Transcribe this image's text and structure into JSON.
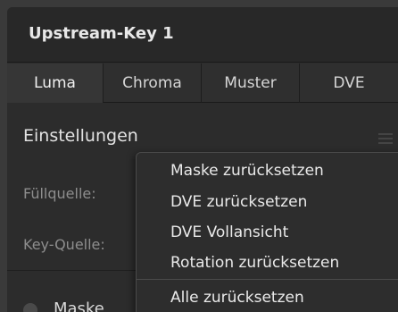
{
  "panel": {
    "title": "Upstream-Key 1",
    "tabs": [
      {
        "label": "Luma",
        "active": true
      },
      {
        "label": "Chroma",
        "active": false
      },
      {
        "label": "Muster",
        "active": false
      },
      {
        "label": "DVE",
        "active": false
      }
    ]
  },
  "settings": {
    "title": "Einstellungen",
    "fill_source_label": "Füllquelle:",
    "key_source_label": "Key-Quelle:",
    "mask_label": "Maske"
  },
  "context_menu": {
    "items": [
      "Maske zurücksetzen",
      "DVE zurücksetzen",
      "DVE Vollansicht",
      "Rotation zurücksetzen",
      "Alle zurücksetzen"
    ]
  }
}
